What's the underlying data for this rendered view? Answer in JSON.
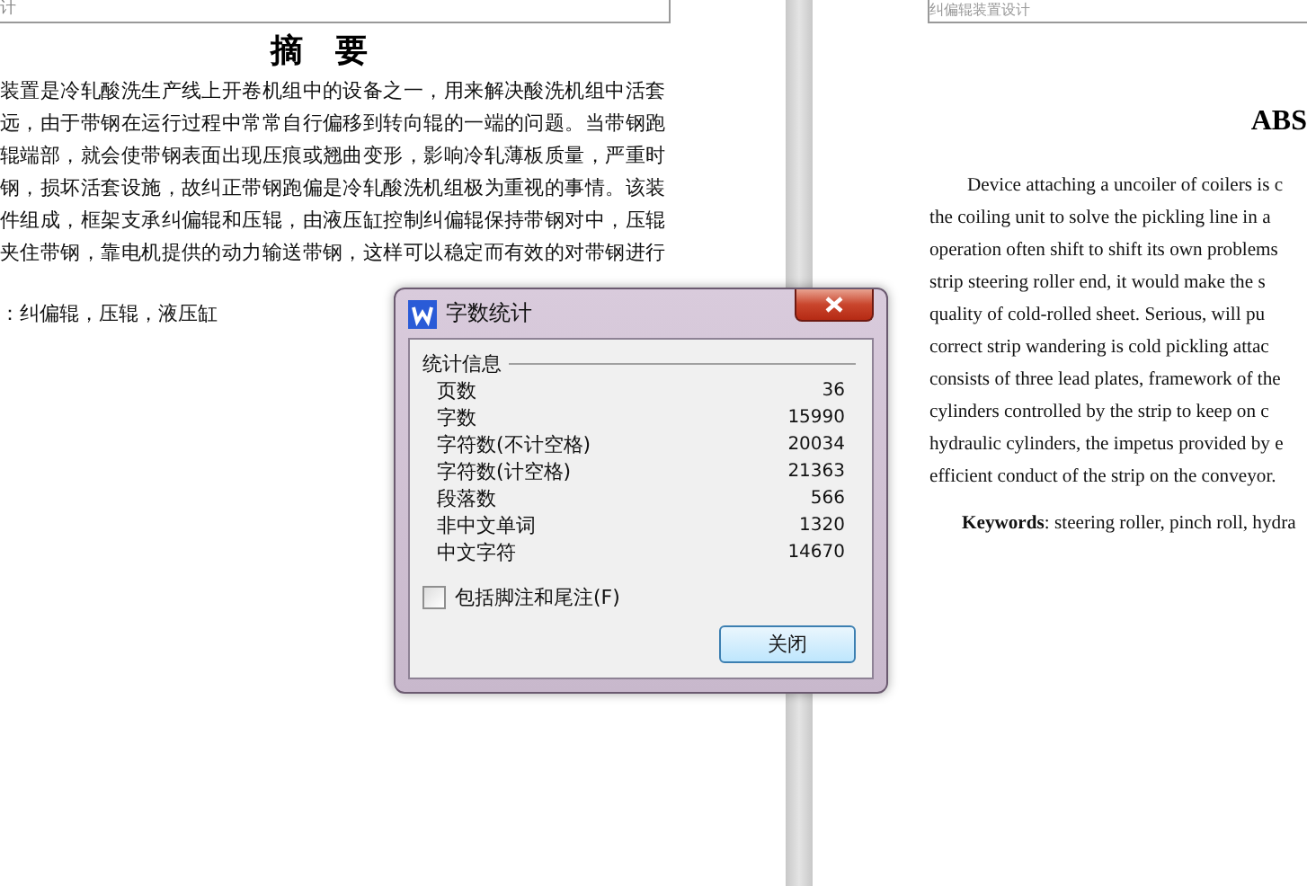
{
  "left_page": {
    "header": "计",
    "title": "摘　要",
    "lines": [
      "装置是冷轧酸洗生产线上开卷机组中的设备之一，用来解决酸洗机组中活套",
      "远，由于带钢在运行过程中常常自行偏移到转向辊的一端的问题。当带钢跑",
      "辊端部，就会使带钢表面出现压痕或翘曲变形，影响冷轧薄板质量，严重时",
      "钢，损坏活套设施，故纠正带钢跑偏是冷轧酸洗机组极为重视的事情。该装",
      "件组成，框架支承纠偏辊和压辊，由液压缸控制纠偏辊保持带钢对中，压辊",
      "夹住带钢，靠电机提供的动力输送带钢，这样可以稳定而有效的对带钢进行"
    ],
    "keywords": "：纠偏辊，压辊，液压缸"
  },
  "right_page": {
    "header": "纠偏辊装置设计",
    "title": "ABS",
    "lines": [
      "Device attaching a uncoiler of coilers is c",
      "the coiling unit to solve the pickling line in a",
      "operation often shift to shift its own problems",
      "strip steering roller end, it would make the s",
      "quality of cold-rolled sheet. Serious, will pu",
      "correct strip wandering is cold pickling attac",
      "consists of three lead plates, framework of the",
      "cylinders controlled by the strip to keep on c",
      "hydraulic cylinders, the impetus provided by e",
      "efficient conduct of the strip on the conveyor."
    ],
    "keywords": "**Keywords**: steering roller, pinch roll, hydra"
  },
  "dialog": {
    "title": "字数统计",
    "group": "统计信息",
    "stats": [
      {
        "label": "页数",
        "value": "36"
      },
      {
        "label": "字数",
        "value": "15990"
      },
      {
        "label": "字符数(不计空格)",
        "value": "20034"
      },
      {
        "label": "字符数(计空格)",
        "value": "21363"
      },
      {
        "label": "段落数",
        "value": "566"
      },
      {
        "label": "非中文单词",
        "value": "1320"
      },
      {
        "label": "中文字符",
        "value": "14670"
      }
    ],
    "checkbox": {
      "label": "包括脚注和尾注(F)",
      "checked": false
    },
    "button": "关闭"
  }
}
